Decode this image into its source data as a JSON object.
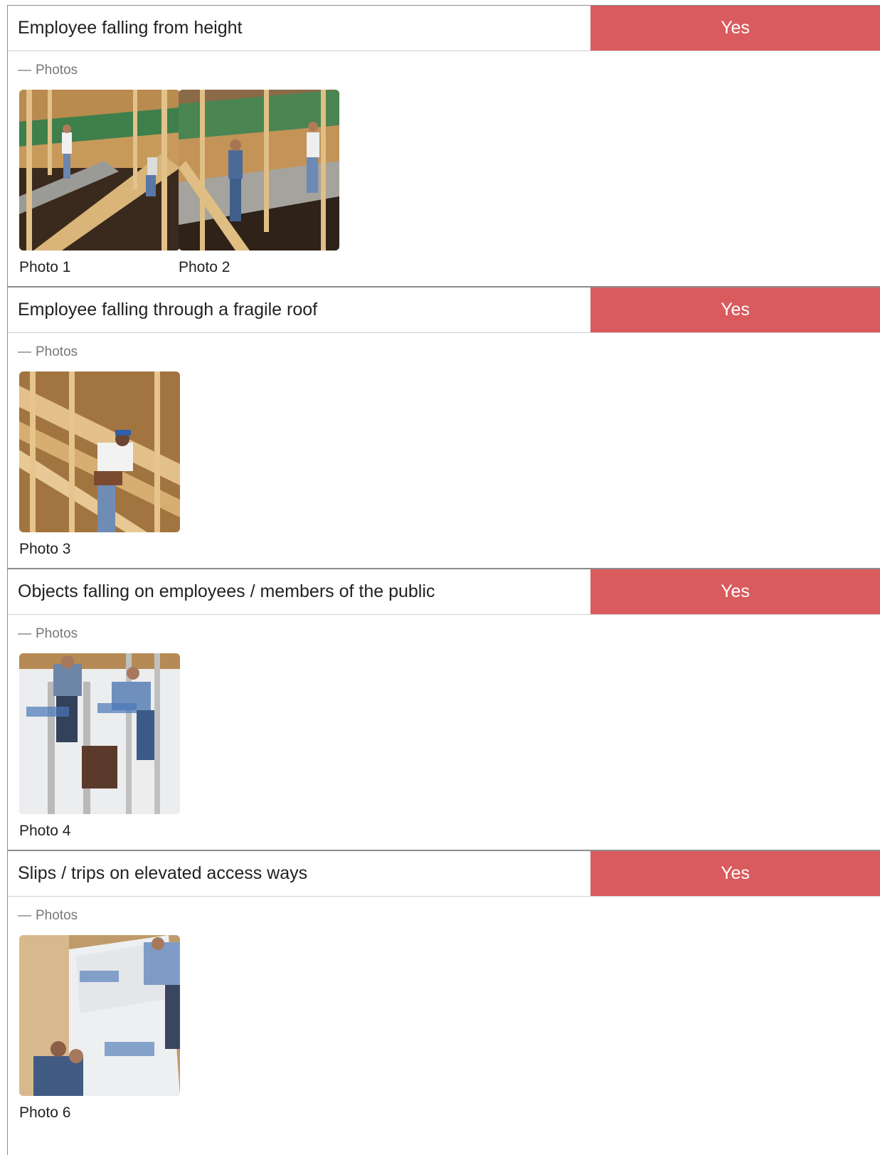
{
  "sections": [
    {
      "question": "Employee falling from height",
      "answer": "Yes",
      "photos_toggle": "Photos",
      "photos": [
        {
          "caption": "Photo 1"
        },
        {
          "caption": "Photo 2"
        }
      ]
    },
    {
      "question": "Employee falling through a fragile roof",
      "answer": "Yes",
      "photos_toggle": "Photos",
      "photos": [
        {
          "caption": "Photo 3"
        }
      ]
    },
    {
      "question": "Objects falling on employees / members of the public",
      "answer": "Yes",
      "photos_toggle": "Photos",
      "photos": [
        {
          "caption": "Photo 4"
        }
      ]
    },
    {
      "question": "Slips / trips on elevated access ways",
      "answer": "Yes",
      "photos_toggle": "Photos",
      "photos": [
        {
          "caption": "Photo 6"
        }
      ]
    }
  ],
  "toggle_glyph": "—",
  "colors": {
    "answer_yes_bg": "#d95b5e",
    "answer_text": "#ffffff",
    "border": "#8c8c8c"
  }
}
